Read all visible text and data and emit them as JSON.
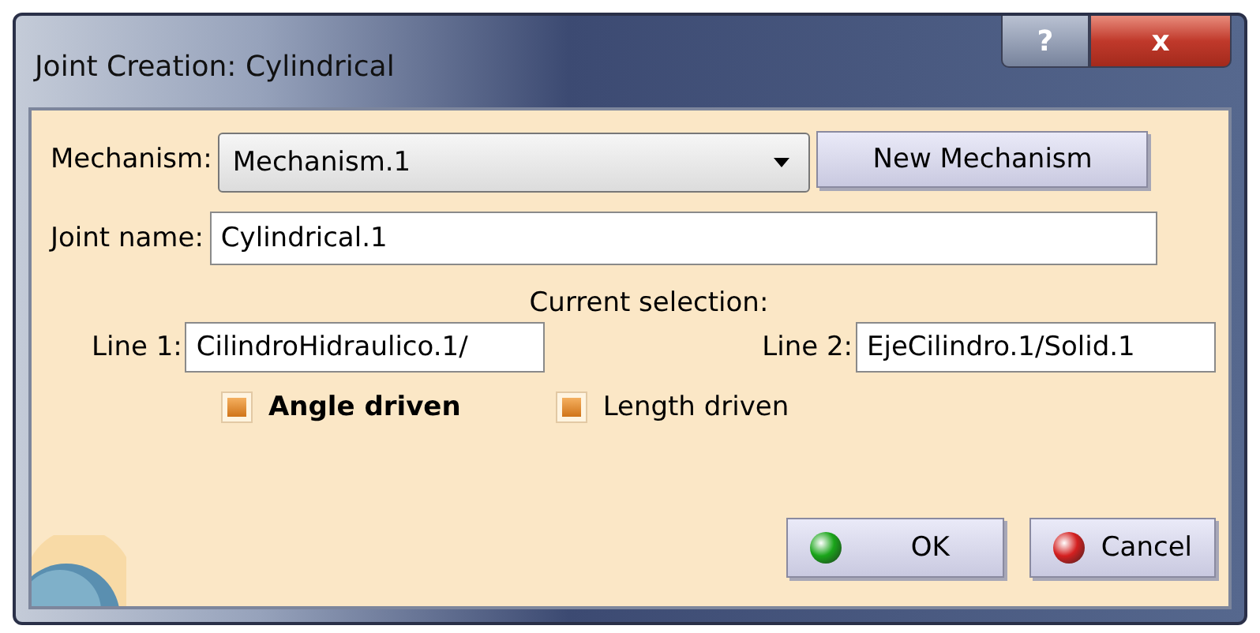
{
  "window": {
    "title": "Joint Creation: Cylindrical",
    "title_buttons": [
      "?",
      "x"
    ]
  },
  "mechanism": {
    "label": "Mechanism:",
    "value": "Mechanism.1",
    "button": "New Mechanism"
  },
  "joint_name": {
    "label": "Joint name:",
    "value": "Cylindrical.1"
  },
  "selection": {
    "heading": "Current selection:",
    "fields": [
      {
        "label": "Line 1:",
        "value": "CilindroHidraulico.1/"
      },
      {
        "label": "Line 2:",
        "value": "EjeCilindro.1/Solid.1"
      }
    ]
  },
  "options": [
    {
      "label": "Angle driven",
      "checked": true,
      "bold": true
    },
    {
      "label": "Length driven",
      "checked": true,
      "bold": false
    }
  ],
  "buttons": [
    {
      "label": "OK",
      "kind": "ok"
    },
    {
      "label": "Cancel",
      "kind": "cancel"
    }
  ]
}
